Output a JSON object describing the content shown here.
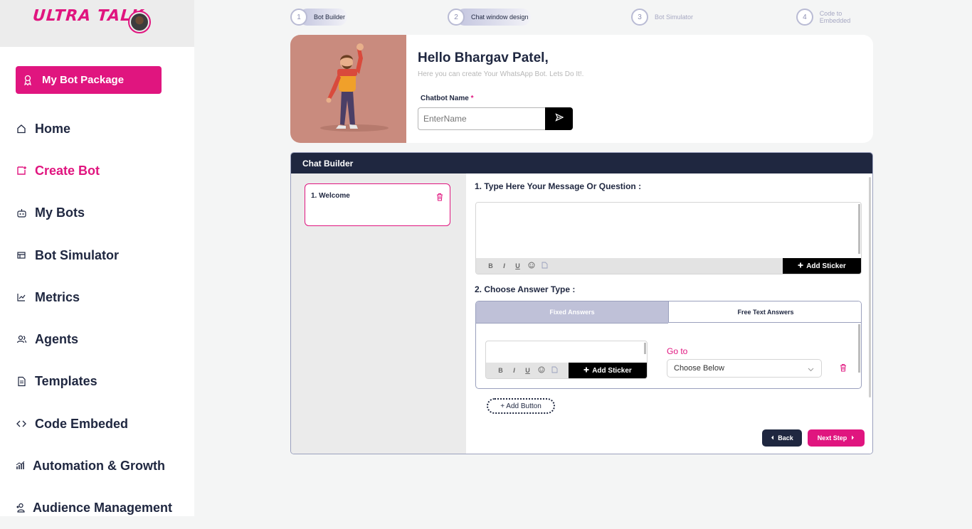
{
  "brand": {
    "logo_text": "ULTRA TALK"
  },
  "sidebar": {
    "package_button": "My Bot Package",
    "items": [
      {
        "label": "Home",
        "icon": "home-icon"
      },
      {
        "label": "Create Bot",
        "icon": "create-bot-icon",
        "active": true
      },
      {
        "label": "My Bots",
        "icon": "robot-icon"
      },
      {
        "label": "Bot Simulator",
        "icon": "simulator-icon"
      },
      {
        "label": "Metrics",
        "icon": "chart-icon"
      },
      {
        "label": "Agents",
        "icon": "users-icon"
      },
      {
        "label": "Templates",
        "icon": "document-icon"
      },
      {
        "label": "Code Embeded",
        "icon": "code-icon"
      },
      {
        "label": "Automation & Growth",
        "icon": "growth-icon"
      },
      {
        "label": "Audience Management",
        "icon": "audience-icon"
      }
    ]
  },
  "stepper": [
    {
      "num": "1",
      "label": "Bot Builder"
    },
    {
      "num": "2",
      "label": "Chat window design"
    },
    {
      "num": "3",
      "label": "Bot Simulator"
    },
    {
      "num": "4",
      "label": "Code to Embedded"
    }
  ],
  "hello": {
    "title": "Hello Bhargav Patel,",
    "subtitle": "Here you can create Your WhatsApp Bot. Lets Do It!.",
    "chatbot_label": "Chatbot Name",
    "required_mark": "*",
    "input_placeholder": "EnterName"
  },
  "builder": {
    "title": "Chat Builder",
    "step_card": "1. Welcome",
    "question_label": "1. Type Here Your Message Or Question :",
    "answer_type_label": "2. Choose Answer Type :",
    "toolbar": [
      "B",
      "I",
      "U"
    ],
    "add_sticker": "Add Sticker",
    "tabs": {
      "fixed": "Fixed Answers",
      "free": "Free Text Answers"
    },
    "goto_label": "Go to",
    "goto_value": "Choose Below",
    "add_button": "+ Add Button",
    "back": "Back",
    "next": "Next Step"
  },
  "colors": {
    "accent": "#e0157f",
    "navy": "#1f2740",
    "muted": "#bfc1d8"
  }
}
